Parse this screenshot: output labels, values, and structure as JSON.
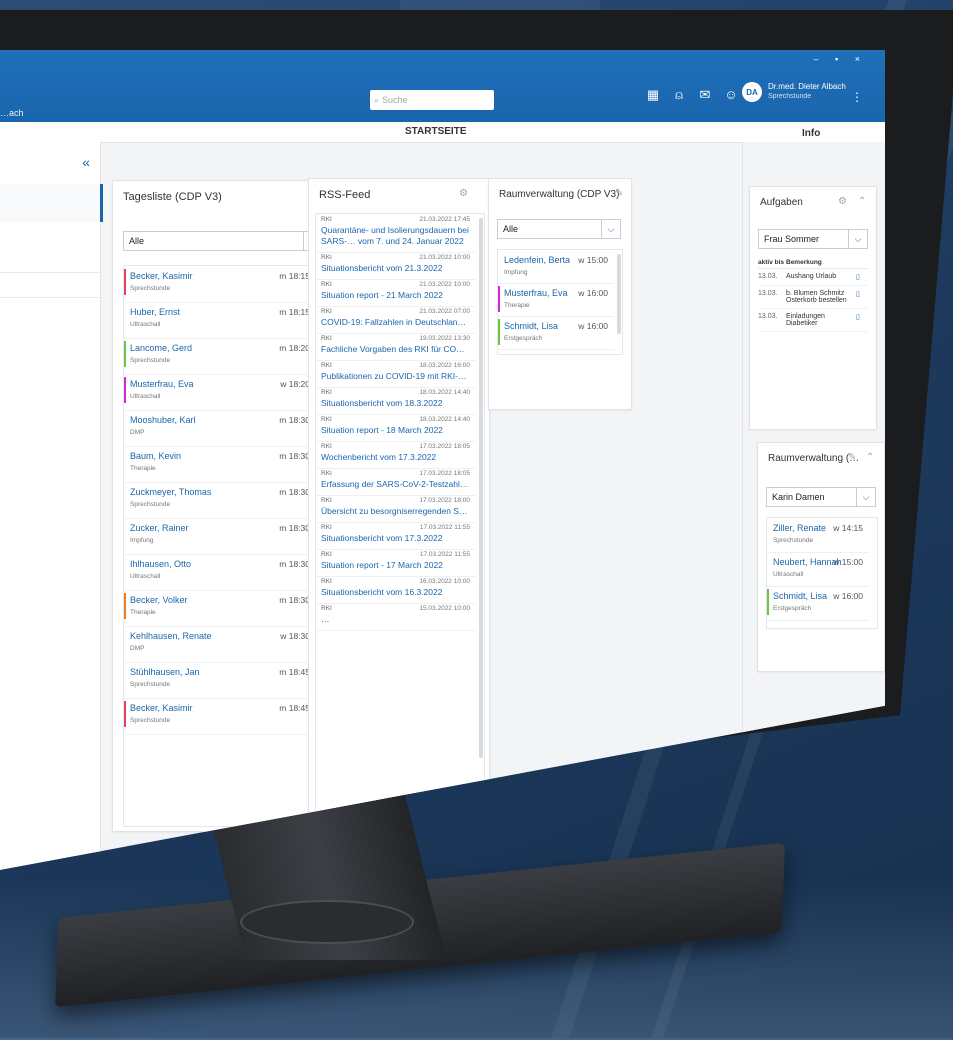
{
  "app": {
    "brand": "…ach",
    "search_placeholder": "Suche",
    "page_title": "STARTSEITE",
    "user_initials": "DA",
    "user_name": "Dr.med. Dieter Albach",
    "user_role": "Sprechstunde",
    "info_title": "Info",
    "window_controls": "– ▪ ×",
    "colors": {
      "primary": "#1a66ad",
      "red": "#e8425a",
      "green": "#6cc644",
      "magenta": "#d02bd6",
      "orange": "#f07a1e"
    }
  },
  "tagesliste": {
    "title": "Tagesliste (CDP V3)",
    "filter": "Alle",
    "rows": [
      {
        "name": "Becker, Kasimir",
        "meta": "Sprechstunde",
        "time": "m 18:15",
        "bar": "#e8425a"
      },
      {
        "name": "Huber, Ernst",
        "meta": "Ultraschall",
        "time": "m 18:15",
        "bar": ""
      },
      {
        "name": "Lancome, Gerd",
        "meta": "Sprechstunde",
        "time": "m 18:20",
        "bar": "#6cc644"
      },
      {
        "name": "Musterfrau, Eva",
        "meta": "Ultraschall",
        "time": "w 18:20",
        "bar": "#d02bd6"
      },
      {
        "name": "Mooshuber, Karl",
        "meta": "DMP",
        "time": "m 18:30",
        "bar": ""
      },
      {
        "name": "Baum, Kevin",
        "meta": "Therapie",
        "time": "m 18:30",
        "bar": ""
      },
      {
        "name": "Zuckmeyer, Thomas",
        "meta": "Sprechstunde",
        "time": "m 18:30",
        "bar": ""
      },
      {
        "name": "Zucker, Rainer",
        "meta": "Impfung",
        "time": "m 18:30",
        "bar": ""
      },
      {
        "name": "Ihlhausen, Otto",
        "meta": "Ultraschall",
        "time": "m 18:30",
        "bar": ""
      },
      {
        "name": "Becker, Volker",
        "meta": "Therapie",
        "time": "m 18:30",
        "bar": "#f07a1e"
      },
      {
        "name": "Kehlhausen, Renate",
        "meta": "DMP",
        "time": "w 18:30",
        "bar": ""
      },
      {
        "name": "Stühlhausen, Jan",
        "meta": "Sprechstunde",
        "time": "m 18:45",
        "bar": ""
      },
      {
        "name": "Becker, Kasimir",
        "meta": "Sprechstunde",
        "time": "m 18:45",
        "bar": "#e8425a"
      }
    ]
  },
  "rss": {
    "title": "RSS-Feed",
    "items": [
      {
        "src": "RKI",
        "date": "21.03.2022 17:45",
        "title": "Quarantäne- und Isolierungsdauern bei SARS-… vom 7. und 24. Januar 2022"
      },
      {
        "src": "RKI",
        "date": "21.03.2022 10:00",
        "title": "Situationsbericht vom 21.3.2022"
      },
      {
        "src": "RKI",
        "date": "21.03.2022 10:00",
        "title": "Situation report - 21 March 2022"
      },
      {
        "src": "RKI",
        "date": "21.03.2022 07:00",
        "title": "COVID-19: Fallzahlen in Deutschland und welt…"
      },
      {
        "src": "RKI",
        "date": "19.03.2022 13:30",
        "title": "Fachliche Vorgaben des RKI für COVID-19-Ge…"
      },
      {
        "src": "RKI",
        "date": "18.03.2022 16:00",
        "title": "Publikationen zu COVID-19 mit RKI-Beteiligung"
      },
      {
        "src": "RKI",
        "date": "18.03.2022 14:40",
        "title": "Situationsbericht vom 18.3.2022"
      },
      {
        "src": "RKI",
        "date": "18.03.2022 14:40",
        "title": "Situation report - 18 March 2022"
      },
      {
        "src": "RKI",
        "date": "17.03.2022 18:05",
        "title": "Wochenbericht vom 17.3.2022"
      },
      {
        "src": "RKI",
        "date": "17.03.2022 18:05",
        "title": "Erfassung der SARS-CoV-2-Testzahlen in Deu…"
      },
      {
        "src": "RKI",
        "date": "17.03.2022 18:00",
        "title": "Übersicht zu besorgniserregenden SARS-CoV-…"
      },
      {
        "src": "RKI",
        "date": "17.03.2022 11:55",
        "title": "Situationsbericht vom 17.3.2022"
      },
      {
        "src": "RKI",
        "date": "17.03.2022 11:55",
        "title": "Situation report - 17 March 2022"
      },
      {
        "src": "RKI",
        "date": "16.03.2022 10:00",
        "title": "Situationsbericht vom 16.3.2022"
      },
      {
        "src": "RKI",
        "date": "15.03.2022 10:00",
        "title": "…"
      }
    ]
  },
  "raum": {
    "title": "Raumverwaltung (CDP V3)",
    "filter": "Alle",
    "rows": [
      {
        "name": "Ledenfein, Berta",
        "meta": "Impfung",
        "time": "w 15:00",
        "bar": ""
      },
      {
        "name": "Musterfrau, Eva",
        "meta": "Therapie",
        "time": "w 16:00",
        "bar": "#d02bd6"
      },
      {
        "name": "Schmidt, Lisa",
        "meta": "Erstgespräch",
        "time": "w 16:00",
        "bar": "#6cc644"
      }
    ]
  },
  "aufgaben": {
    "title": "Aufgaben",
    "filter": "Frau Sommer",
    "col_date": "aktiv bis",
    "col_note": "Bemerkung",
    "rows": [
      {
        "date": "13.03.",
        "note": "Aushang Urlaub"
      },
      {
        "date": "13.03.",
        "note": "b. Blumen Schmitz Osterkorb bestellen"
      },
      {
        "date": "13.03.",
        "note": "Einladungen Diabetiker"
      }
    ]
  },
  "raum_small": {
    "title": "Raumverwaltung (…",
    "filter": "Karin Damen",
    "rows": [
      {
        "name": "Ziller, Renate",
        "meta": "Sprechstunde",
        "time": "w 14:15",
        "bar": ""
      },
      {
        "name": "Neubert, Hannah",
        "meta": "Ultraschall",
        "time": "w 15:00",
        "bar": ""
      },
      {
        "name": "Schmidt, Lisa",
        "meta": "Erstgespräch",
        "time": "w 16:00",
        "bar": "#6cc644"
      }
    ]
  }
}
